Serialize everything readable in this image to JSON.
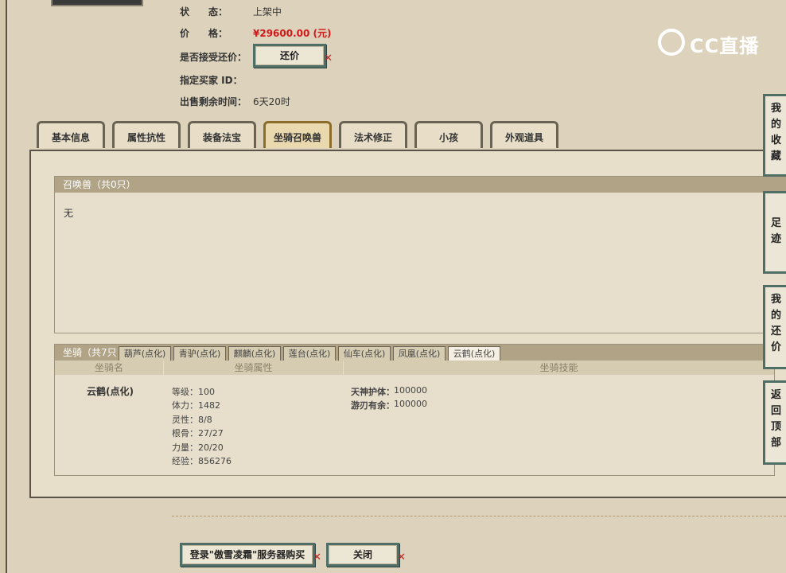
{
  "status": {
    "label": "状　　态：",
    "value": "上架中"
  },
  "price": {
    "label": "价　　格：",
    "value": "¥29600.00 (元)"
  },
  "counter_offer": {
    "label": "是否接受还价：",
    "button": "还价"
  },
  "buyer_id": {
    "label": "指定买家 ID："
  },
  "time_left": {
    "label": "出售剩余时间：",
    "value": "6天20时"
  },
  "logo_text": "CC直播",
  "tabs": [
    "基本信息",
    "属性抗性",
    "装备法宝",
    "坐骑召唤兽",
    "法术修正",
    "小孩",
    "外观道具"
  ],
  "summon_section": {
    "header": "召唤兽（共0只）",
    "content": "无"
  },
  "mount_section": {
    "header": "坐骑（共7只",
    "subtabs": [
      "葫芦(点化)",
      "青驴(点化)",
      "麒麟(点化)",
      "莲台(点化)",
      "仙车(点化)",
      "凤凰(点化)",
      "云鹤(点化)"
    ],
    "columns": [
      "坐骑名",
      "坐骑属性",
      "坐骑技能"
    ],
    "selected": {
      "name": "云鹤(点化)",
      "attributes": [
        "等级：100",
        "体力：1482",
        "灵性：8/8",
        "根骨：27/27",
        "力量：20/20",
        "经验：856276"
      ],
      "skills": [
        {
          "name": "天神护体：",
          "value": "100000"
        },
        {
          "name": "游刃有余：",
          "value": "100000"
        }
      ]
    }
  },
  "side_buttons": [
    "我的收藏",
    "足迹",
    "我的还价",
    "返回顶部"
  ],
  "bottom": {
    "buy_button": "登录\"傲雪凌霜\"服务器购买",
    "close_button": "关闭"
  }
}
